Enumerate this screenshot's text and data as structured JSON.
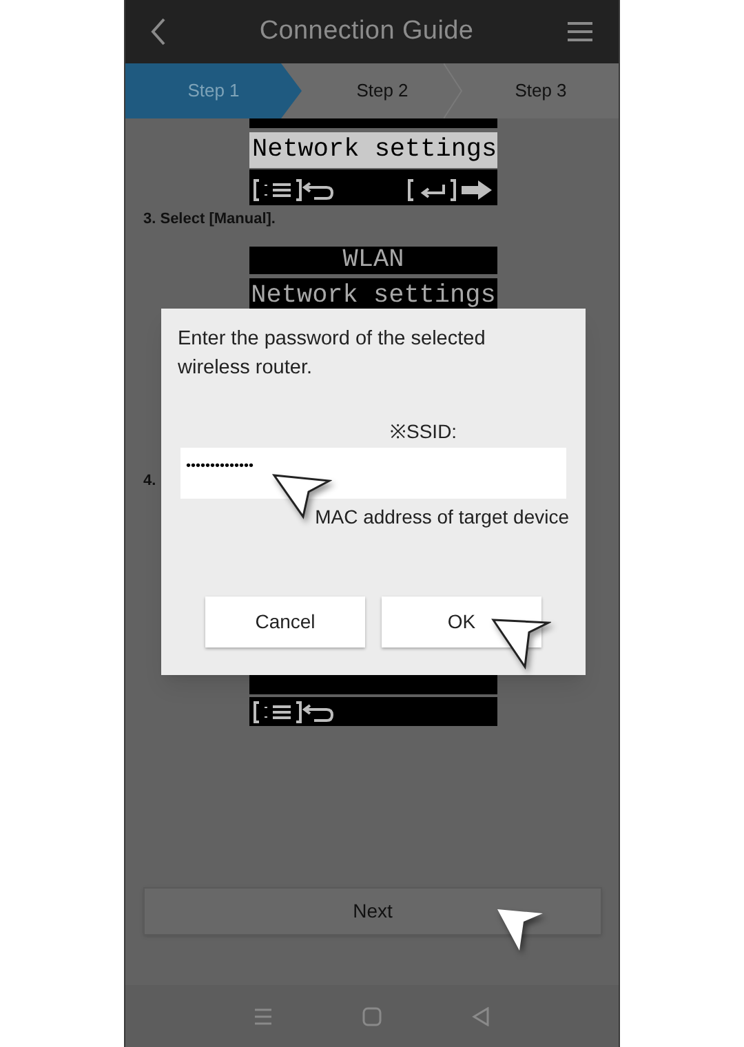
{
  "header": {
    "title": "Connection Guide"
  },
  "steps": [
    {
      "label": "Step 1",
      "selected": true
    },
    {
      "label": "Step 2",
      "selected": false
    },
    {
      "label": "Step 3",
      "selected": false
    }
  ],
  "lcd_top": {
    "rows": [
      {
        "text": "Network settings",
        "selected": true
      }
    ]
  },
  "instruction_3": "3. Select [Manual].",
  "lcd_middle": {
    "rows": [
      {
        "text": "WLAN",
        "selected": false
      },
      {
        "text": "Network settings",
        "selected": false
      }
    ]
  },
  "instruction_4": "4.",
  "dialog": {
    "message": "Enter the password of the selected wireless router.",
    "ssid_label": "※SSID:",
    "password_value": "••••••••••••••",
    "mac_label": "MAC address of target device",
    "buttons": [
      "Cancel",
      "OK"
    ]
  },
  "next_button": "Next"
}
